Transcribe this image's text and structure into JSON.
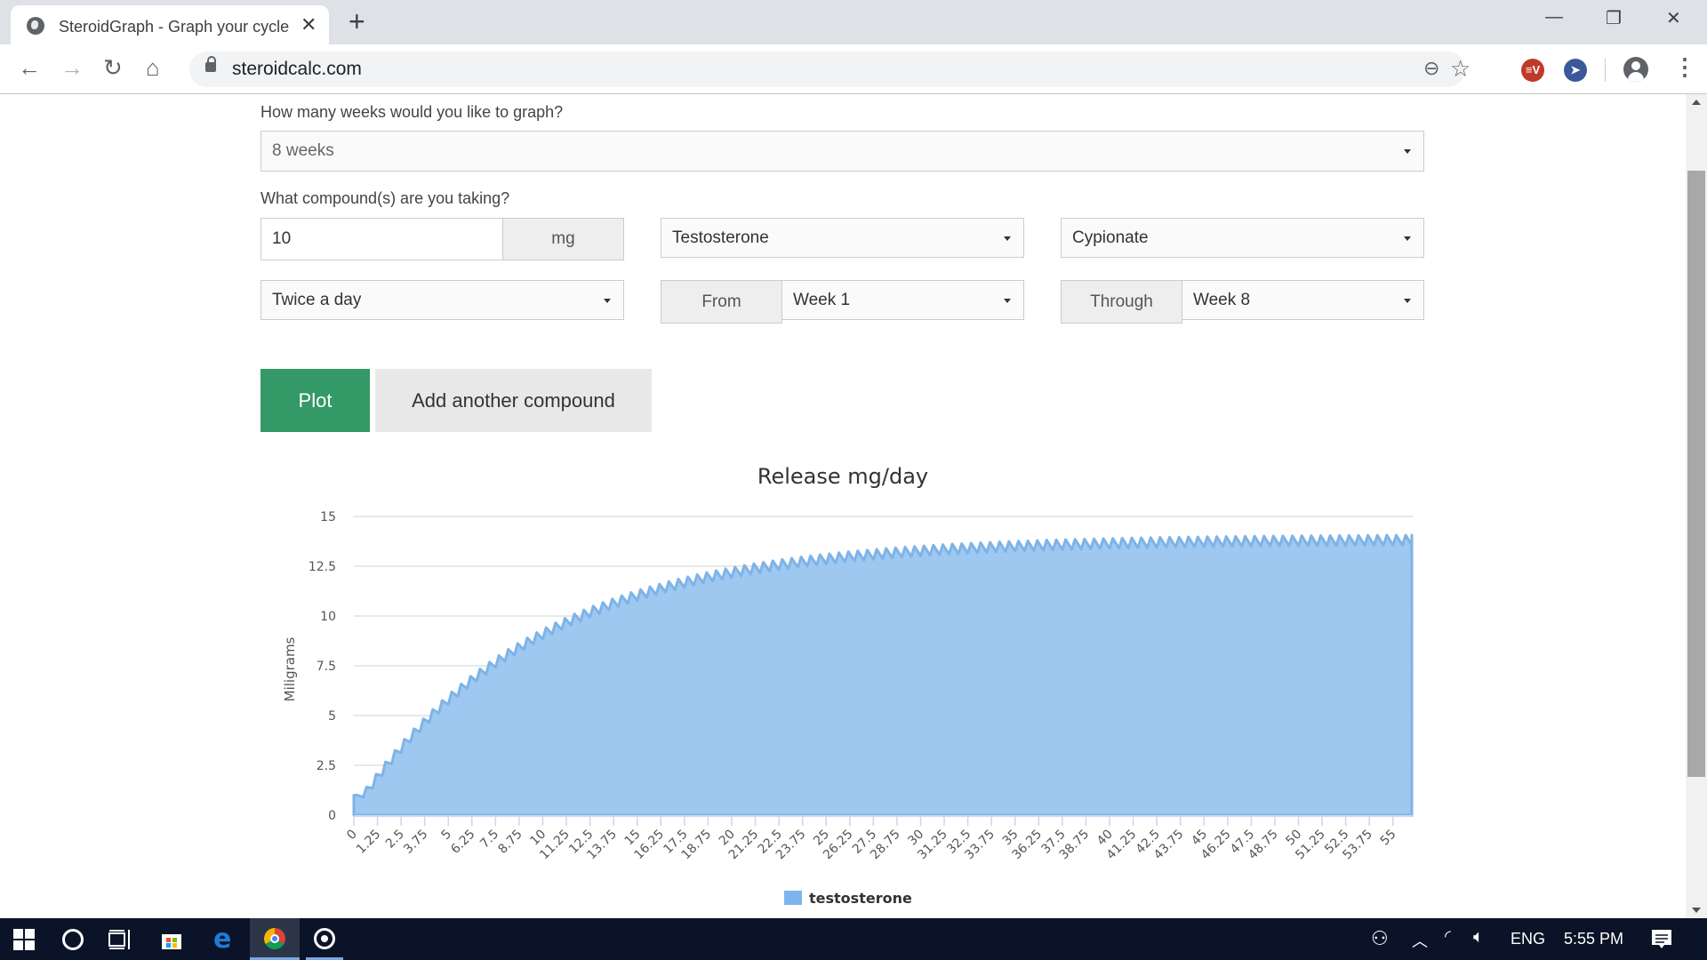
{
  "browser": {
    "tab_title": "SteroidGraph - Graph your cycle",
    "tab_close": "✕",
    "new_tab": "+",
    "url": "steroidcalc.com",
    "window_controls": {
      "minimize": "—",
      "restore": "❐",
      "close": "✕"
    },
    "nav": {
      "back": "←",
      "forward": "→",
      "reload": "↻",
      "home": "⌂"
    },
    "icons": {
      "zoom": "⊖",
      "bookmark": "☆",
      "menu": "⋮"
    },
    "extensions": [
      {
        "name": "expressvpn",
        "glyph": "≡V",
        "color": "#c0392b"
      },
      {
        "name": "cursor-extension",
        "glyph": "➤",
        "color": "#3b5998"
      }
    ]
  },
  "form": {
    "weeks_question": "How many weeks would you like to graph?",
    "weeks_value": "8 weeks",
    "compound_question": "What compound(s) are you taking?",
    "dose_value": "10",
    "dose_unit": "mg",
    "compound_value": "Testosterone",
    "ester_value": "Cypionate",
    "frequency_value": "Twice a day",
    "from_label": "From",
    "from_value": "Week 1",
    "through_label": "Through",
    "through_value": "Week 8",
    "plot_button": "Plot",
    "add_compound_button": "Add another compound"
  },
  "colors": {
    "plot_green": "#339966",
    "area_fill": "#9ec8ef",
    "area_line": "#7eb3e8",
    "legend_swatch": "#7cb5ec"
  },
  "chart_data": {
    "type": "area",
    "title": "Release mg/day",
    "xlabel": "",
    "ylabel": "Miligrams",
    "xlim": [
      0,
      56
    ],
    "ylim": [
      0,
      15
    ],
    "yticks": [
      0,
      2.5,
      5,
      7.5,
      10,
      12.5,
      15
    ],
    "xtick_step": 1.25,
    "xtick_labels": [
      "0",
      "1.25",
      "2.5",
      "3.75",
      "5",
      "6.25",
      "7.5",
      "8.75",
      "10",
      "11.25",
      "12.5",
      "13.75",
      "15",
      "16.25",
      "17.5",
      "18.75",
      "20",
      "21.25",
      "22.5",
      "23.75",
      "25",
      "26.25",
      "27.5",
      "28.75",
      "30",
      "31.25",
      "32.5",
      "33.75",
      "35",
      "36.25",
      "37.5",
      "38.75",
      "40",
      "41.25",
      "42.5",
      "43.75",
      "45",
      "46.25",
      "47.5",
      "48.75",
      "50",
      "51.25",
      "52.5",
      "53.75",
      "55"
    ],
    "grid": true,
    "legend": {
      "position": "bottom",
      "entries": [
        "testosterone"
      ]
    },
    "series": [
      {
        "name": "testosterone",
        "model": "twice-daily dosing of 10 mg accumulating toward steady state",
        "steady_state_peak": 14.1,
        "steady_state_trough": 13.6,
        "start_value": 1.0,
        "dose_interval_days": 0.5,
        "last_x": 56
      }
    ]
  },
  "taskbar": {
    "tray_language": "ENG",
    "tray_time": "5:55 PM"
  }
}
